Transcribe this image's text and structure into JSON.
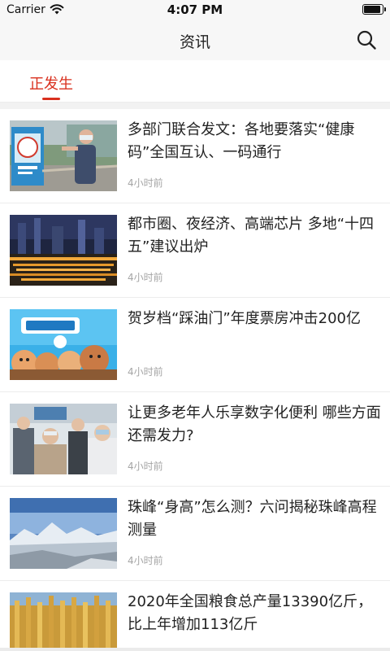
{
  "status_bar": {
    "carrier": "Carrier",
    "time": "4:07 PM",
    "battery_level": 0.95
  },
  "header": {
    "title": "资讯",
    "search_icon": "search-icon"
  },
  "tabs": [
    {
      "label": "正发生",
      "active": true
    }
  ],
  "colors": {
    "accent": "#d9301e",
    "time_text": "#a5a5a5",
    "divider": "#ececec"
  },
  "news": [
    {
      "title": "多部门联合发文：各地要落实“健康码”全国互认、一码通行",
      "time": "4小时前",
      "thumbnail": "health-code-checkpoint-photo"
    },
    {
      "title": "都市圈、夜经济、高端芯片 多地“十四五”建议出炉",
      "time": "4小时前",
      "thumbnail": "city-night-skyline-photo"
    },
    {
      "title": "贺岁档“踩油门”年度票房冲击200亿",
      "time": "4小时前",
      "thumbnail": "croods-2-movie-poster"
    },
    {
      "title": "让更多老年人乐享数字化便利 哪些方面还需发力?",
      "time": "4小时前",
      "thumbnail": "seniors-using-phones-photo"
    },
    {
      "title": "珠峰“身高”怎么测？六问揭秘珠峰高程测量",
      "time": "4小时前",
      "thumbnail": "snowy-mountain-landscape-photo"
    },
    {
      "title": "2020年全国粮食总产量13390亿斤，比上年增加113亿斤",
      "time": "",
      "thumbnail": "wheat-field-photo"
    }
  ]
}
